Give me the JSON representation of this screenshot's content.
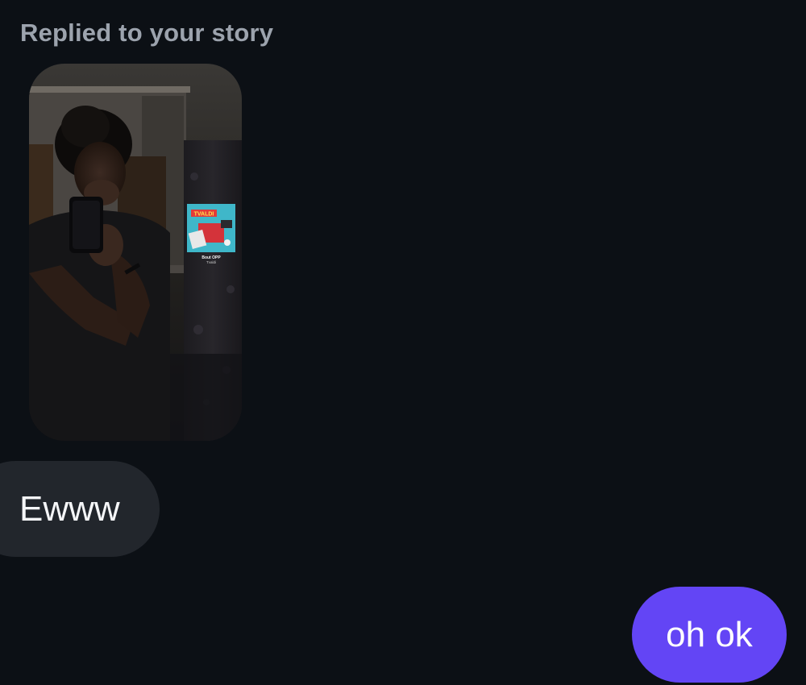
{
  "thread": {
    "reply_caption": "Replied to your story",
    "story": {
      "music_sticker": {
        "title": "Bout OPP",
        "artist": "Tvaldi",
        "cover_text": "TVALDI"
      }
    },
    "messages": [
      {
        "direction": "received",
        "text": "Ewww"
      },
      {
        "direction": "sent",
        "text": "oh ok",
        "bubble_color": "#6345f5"
      }
    ]
  },
  "colors": {
    "background": "#0c1015",
    "received_bubble": "#22262c",
    "sent_bubble": "#6345f5",
    "caption_text": "#9ca3ad"
  }
}
